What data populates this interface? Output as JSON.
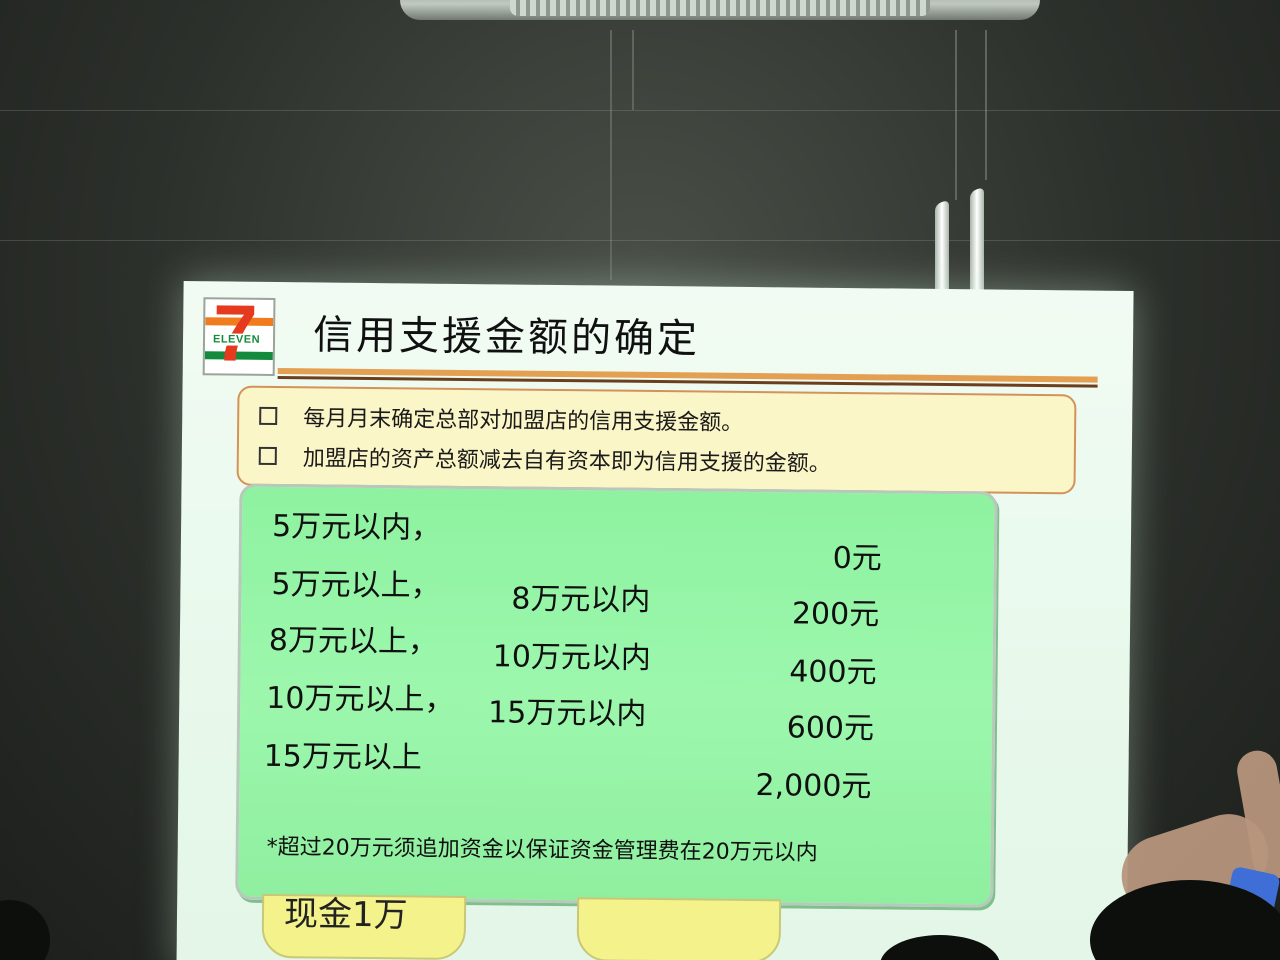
{
  "slide": {
    "logo": {
      "digit": "7",
      "word": "ELEVEN",
      "colors": {
        "orange": "#f07c1e",
        "green": "#148a3c",
        "red": "#e63a1f"
      }
    },
    "title": "信用支援金额的确定",
    "bullets": [
      "每月月末确定总部对加盟店的信用支援金额。",
      "加盟店的资产总额减去自有资本即为信用支援的金额。"
    ],
    "rows": [
      {
        "from": "5万元以内，",
        "to": "",
        "amount": "0元"
      },
      {
        "from": "5万元以上，",
        "to": "8万元以内",
        "amount": "200元"
      },
      {
        "from": "8万元以上，",
        "to": "10万元以内",
        "amount": "400元"
      },
      {
        "from": "10万元以上，",
        "to": "15万元以内",
        "amount": "600元"
      },
      {
        "from": "15万元以上",
        "to": "",
        "amount": "2,000元"
      }
    ],
    "footnote": "*超过20万元须追加资金以保证资金管理费在20万元以内",
    "partial_label": "现金1万",
    "colors": {
      "bullet_box_fill": "#fbf6c7",
      "bullet_box_border": "#d3925a",
      "table_fill": "#9cf7ad",
      "title_rule": "#e3a052"
    }
  }
}
